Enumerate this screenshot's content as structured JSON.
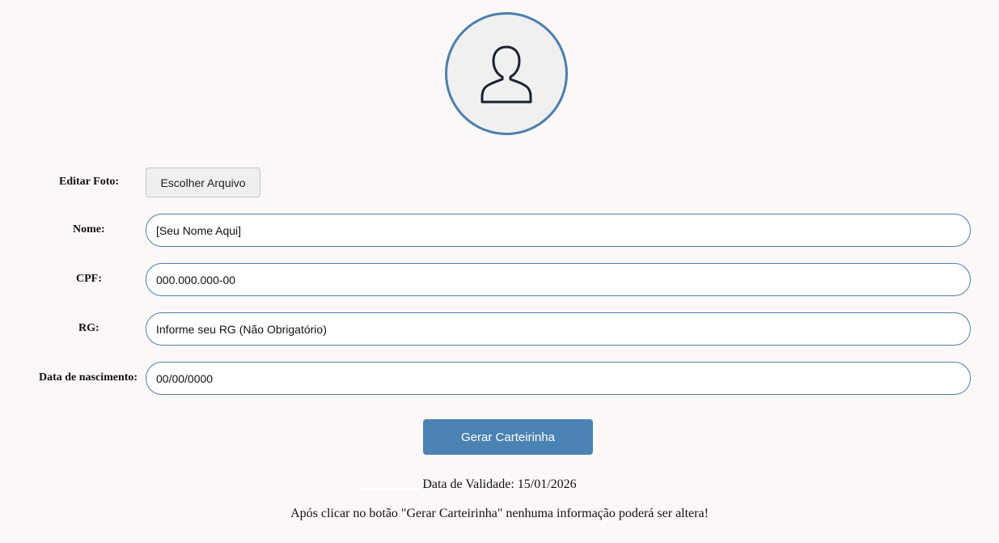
{
  "avatar": {
    "icon": "user-silhouette-icon",
    "border_color": "#4a7fb0"
  },
  "form": {
    "photo": {
      "label": "Editar Foto:",
      "button_label": "Escolher Arquivo"
    },
    "name": {
      "label": "Nome:",
      "placeholder": "[Seu Nome Aqui]"
    },
    "cpf": {
      "label": "CPF:",
      "placeholder": "000.000.000-00"
    },
    "rg": {
      "label": "RG:",
      "placeholder": "Informe seu RG (Não Obrigatório)"
    },
    "birth": {
      "label": "Data de nascimento:",
      "placeholder": "00/00/0000"
    }
  },
  "submit_label": "Gerar Carteirinha",
  "validity_text": "Data de Validade: 15/01/2026",
  "warning_text": "Após clicar no botão \"Gerar Carteirinha\" nenhuma informação poderá ser altera!",
  "colors": {
    "accent": "#4a82b4",
    "background": "#fcf8f7"
  }
}
